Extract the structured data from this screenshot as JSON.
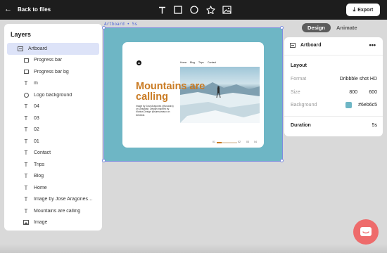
{
  "topbar": {
    "back_label": "Back to files",
    "export_label": "Export",
    "tools": [
      "text-tool-icon",
      "rectangle-tool-icon",
      "ellipse-tool-icon",
      "star-tool-icon",
      "image-tool-icon"
    ]
  },
  "layers": {
    "title": "Layers",
    "items": [
      {
        "label": "Artboard",
        "icon": "artboard-icon",
        "selected": true
      },
      {
        "label": "Progress bar",
        "icon": "rectangle-icon"
      },
      {
        "label": "Progress bar bg",
        "icon": "rectangle-icon"
      },
      {
        "label": "m",
        "icon": "text-icon"
      },
      {
        "label": "Logo background",
        "icon": "ellipse-icon"
      },
      {
        "label": "04",
        "icon": "text-icon"
      },
      {
        "label": "03",
        "icon": "text-icon"
      },
      {
        "label": "02",
        "icon": "text-icon"
      },
      {
        "label": "01",
        "icon": "text-icon"
      },
      {
        "label": "Contact",
        "icon": "text-icon"
      },
      {
        "label": "Trips",
        "icon": "text-icon"
      },
      {
        "label": "Blog",
        "icon": "text-icon"
      },
      {
        "label": "Home",
        "icon": "text-icon"
      },
      {
        "label": "Image by Jose Aragones…",
        "icon": "text-icon"
      },
      {
        "label": "Mountains are calling",
        "icon": "text-icon"
      },
      {
        "label": "Image",
        "icon": "image-icon"
      }
    ]
  },
  "canvas": {
    "artboard_label": "Artboard • 5s",
    "background": "#6eb6c5",
    "design": {
      "logo_letter": "m",
      "nav": [
        "Home",
        "Blog",
        "Trips",
        "Contact"
      ],
      "headline": "Mountains are calling",
      "credit": "Image by Jose Aragones (@voactra) on Unsplash. Design inspired by Mobius Design @sumsumaux on Dribbble.",
      "page_numbers": [
        "01",
        "02",
        "03",
        "04"
      ],
      "progress": 0.25,
      "accent": "#c97a22"
    }
  },
  "panel": {
    "tabs": [
      "Design",
      "Animate"
    ],
    "active_tab": "Design",
    "header_title": "Artboard",
    "more_label": "•••",
    "layout_title": "Layout",
    "format_label": "Format",
    "format_value": "Dribbble shot HD",
    "size_label": "Size",
    "size_width": "800",
    "size_height": "600",
    "background_label": "Background",
    "background_value": "#6eb6c5",
    "duration_label": "Duration",
    "duration_value": "5s"
  },
  "help": {
    "icon": "chat-help-icon"
  }
}
